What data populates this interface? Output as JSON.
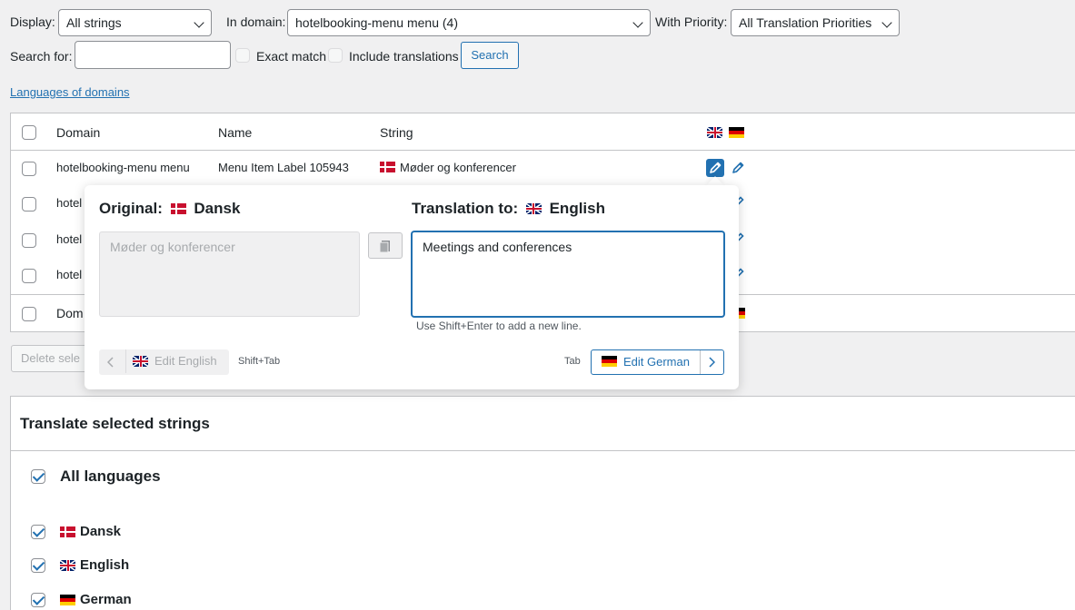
{
  "filters": {
    "display_label": "Display:",
    "display_value": "All strings",
    "domain_label": "In domain:",
    "domain_value": "hotelbooking-menu menu (4)",
    "priority_label": "With Priority:",
    "priority_value": "All Translation Priorities",
    "search_label": "Search for:",
    "search_value": "",
    "exact_match_label": "Exact match",
    "include_translations_label": "Include translations",
    "search_button": "Search",
    "languages_link": "Languages of domains"
  },
  "table": {
    "headers": {
      "domain": "Domain",
      "name": "Name",
      "string": "String"
    },
    "rows": [
      {
        "domain": "hotelbooking-menu menu",
        "name": "Menu Item Label 105943",
        "string": "Møder og konferencer"
      },
      {
        "domain": "hotel"
      },
      {
        "domain": "hotel"
      },
      {
        "domain": "hotel"
      }
    ],
    "footer_domain": "Dom",
    "delete_button": "Delete sele"
  },
  "popup": {
    "original_label": "Original:",
    "original_lang": "Dansk",
    "original_text": "Møder og konferencer",
    "translation_label": "Translation to:",
    "translation_lang": "English",
    "translation_value": "Meetings and conferences",
    "hint": "Use Shift+Enter to add a new line.",
    "prev_button": "Edit English",
    "prev_shortcut": "Shift+Tab",
    "next_shortcut": "Tab",
    "next_button": "Edit German"
  },
  "translate_panel": {
    "title": "Translate selected strings",
    "all_languages": "All languages",
    "languages": [
      "Dansk",
      "English",
      "German"
    ]
  },
  "colors": {
    "accent": "#2271b1",
    "active_pencil_bg": "#2271b1"
  }
}
